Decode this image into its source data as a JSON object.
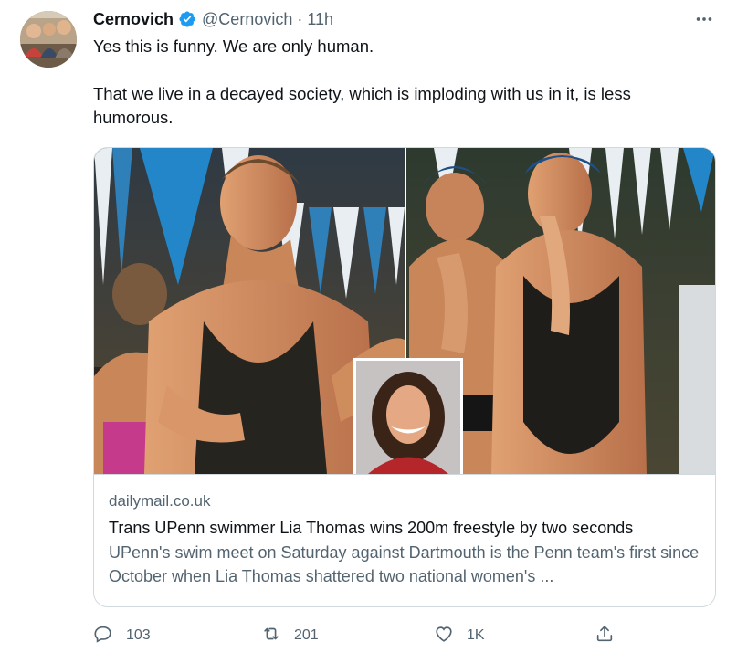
{
  "author": {
    "name": "Cernovich",
    "handle": "@Cernovich",
    "separator": "·",
    "time": "11h",
    "verified": true,
    "verified_color": "#1d9bf0"
  },
  "tweet": {
    "paragraphs": [
      "Yes this is funny. We are only human.",
      "That we live in a decayed society, which is imploding with us in it, is less humorous."
    ]
  },
  "card": {
    "domain": "dailymail.co.uk",
    "title": "Trans UPenn swimmer Lia Thomas wins 200m freestyle by two seconds",
    "description": "UPenn's swim meet on Saturday against Dartmouth is the Penn team's first since October when Lia Thomas shattered two national women's ..."
  },
  "actions": {
    "reply": {
      "icon": "reply-icon",
      "count": "103"
    },
    "retweet": {
      "icon": "retweet-icon",
      "count": "201"
    },
    "like": {
      "icon": "heart-icon",
      "count": "1K"
    },
    "share": {
      "icon": "share-icon"
    }
  },
  "colors": {
    "text": "#0f1419",
    "secondary": "#536471",
    "border": "#cfd9de"
  }
}
